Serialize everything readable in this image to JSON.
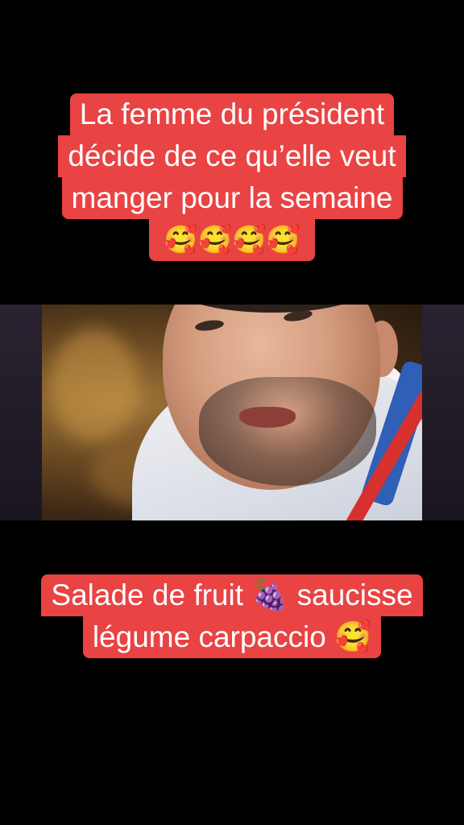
{
  "top_caption": {
    "line1": "La femme du président",
    "line2": "décide de ce qu’elle veut",
    "line3": "manger pour la semaine",
    "emoji": "🥰🥰🥰🥰"
  },
  "bottom_caption": {
    "line1": "Salade de fruit 🍇 saucisse",
    "line2": "légume carpaccio 🥰"
  },
  "colors": {
    "caption_bg": "#e94343",
    "background": "#000000",
    "shirt_blue": "#2f5fb6",
    "shirt_red": "#d6302f"
  }
}
